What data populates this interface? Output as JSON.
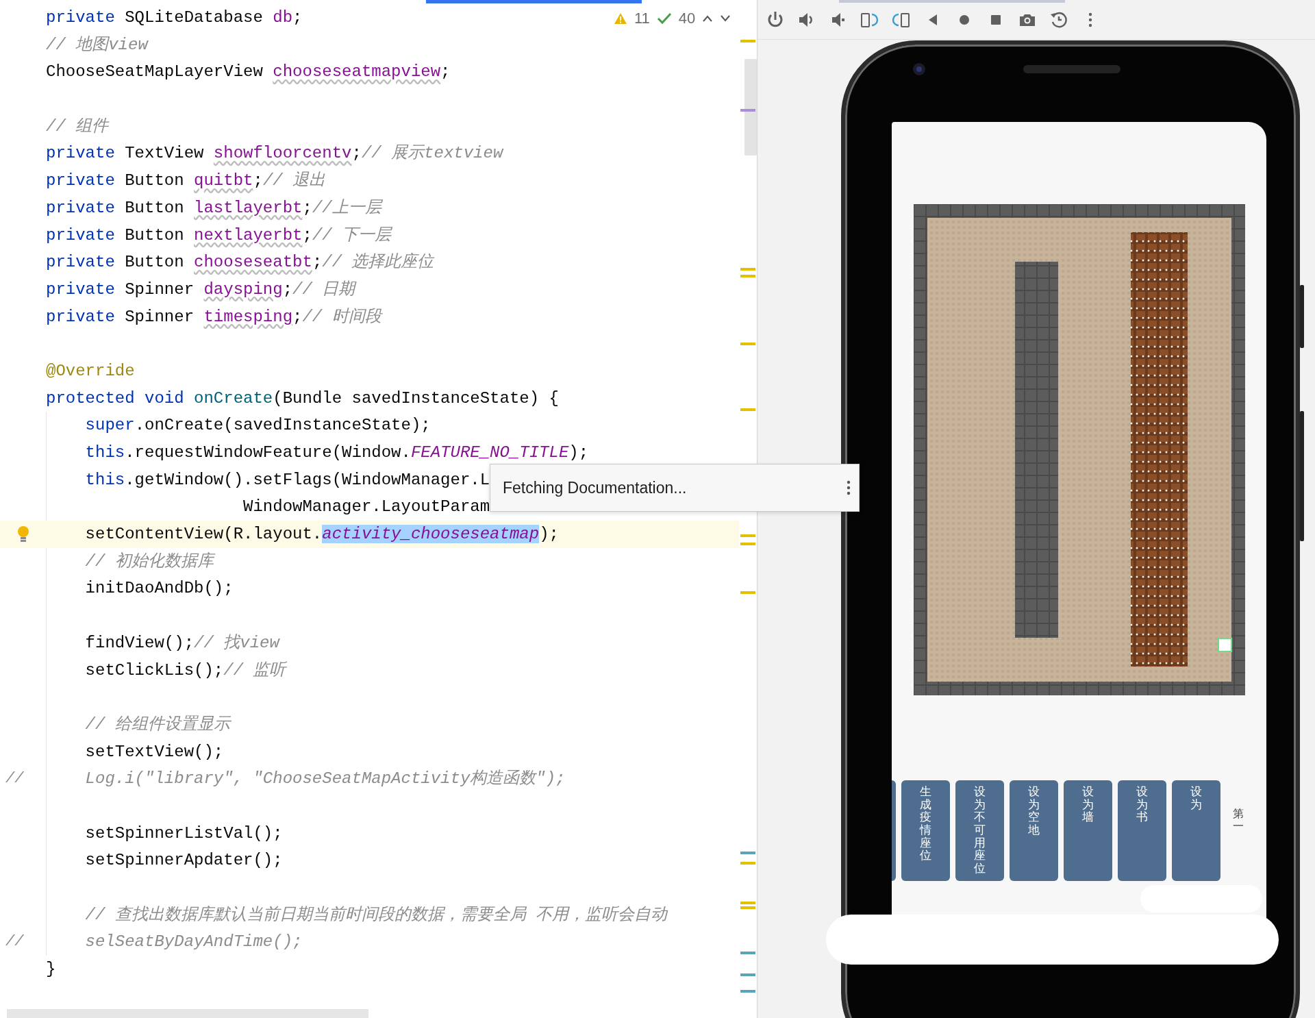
{
  "editor": {
    "inspections": {
      "warnings": "11",
      "weak_warnings": "40"
    },
    "lines": [
      {
        "tokens": [
          {
            "text": "private ",
            "kind": "keyword"
          },
          {
            "text": "SQLiteDatabase ",
            "kind": "plain"
          },
          {
            "text": "db",
            "kind": "field"
          },
          {
            "text": ";",
            "kind": "plain"
          }
        ]
      },
      {
        "tokens": [
          {
            "text": "// 地图view",
            "kind": "comment"
          }
        ]
      },
      {
        "tokens": [
          {
            "text": "ChooseSeatMapLayerView ",
            "kind": "plain"
          },
          {
            "text": "chooseseatmapview",
            "kind": "unusedfield"
          },
          {
            "text": ";",
            "kind": "plain"
          }
        ]
      },
      {
        "kind": "blank"
      },
      {
        "tokens": [
          {
            "text": "// 组件",
            "kind": "comment"
          }
        ]
      },
      {
        "tokens": [
          {
            "text": "private ",
            "kind": "keyword"
          },
          {
            "text": "TextView ",
            "kind": "plain"
          },
          {
            "text": "showfloorcentv",
            "kind": "unusedfield"
          },
          {
            "text": ";",
            "kind": "plain"
          },
          {
            "text": "// 展示textview",
            "kind": "comment"
          }
        ]
      },
      {
        "tokens": [
          {
            "text": "private ",
            "kind": "keyword"
          },
          {
            "text": "Button ",
            "kind": "plain"
          },
          {
            "text": "quitbt",
            "kind": "unusedfield"
          },
          {
            "text": ";",
            "kind": "plain"
          },
          {
            "text": "// 退出",
            "kind": "comment"
          }
        ]
      },
      {
        "tokens": [
          {
            "text": "private ",
            "kind": "keyword"
          },
          {
            "text": "Button ",
            "kind": "plain"
          },
          {
            "text": "lastlayerbt",
            "kind": "unusedfield"
          },
          {
            "text": ";",
            "kind": "plain"
          },
          {
            "text": "//上一层",
            "kind": "comment"
          }
        ]
      },
      {
        "tokens": [
          {
            "text": "private ",
            "kind": "keyword"
          },
          {
            "text": "Button ",
            "kind": "plain"
          },
          {
            "text": "nextlayerbt",
            "kind": "unusedfield"
          },
          {
            "text": ";",
            "kind": "plain"
          },
          {
            "text": "// 下一层",
            "kind": "comment"
          }
        ]
      },
      {
        "tokens": [
          {
            "text": "private ",
            "kind": "keyword"
          },
          {
            "text": "Button ",
            "kind": "plain"
          },
          {
            "text": "chooseseatbt",
            "kind": "unusedfield"
          },
          {
            "text": ";",
            "kind": "plain"
          },
          {
            "text": "// 选择此座位",
            "kind": "comment"
          }
        ]
      },
      {
        "tokens": [
          {
            "text": "private ",
            "kind": "keyword"
          },
          {
            "text": "Spinner ",
            "kind": "plain"
          },
          {
            "text": "daysping",
            "kind": "unusedfield"
          },
          {
            "text": ";",
            "kind": "plain"
          },
          {
            "text": "// 日期",
            "kind": "comment"
          }
        ]
      },
      {
        "tokens": [
          {
            "text": "private ",
            "kind": "keyword"
          },
          {
            "text": "Spinner ",
            "kind": "plain"
          },
          {
            "text": "timesping",
            "kind": "unusedfield"
          },
          {
            "text": ";",
            "kind": "plain"
          },
          {
            "text": "// 时间段",
            "kind": "comment"
          }
        ]
      },
      {
        "kind": "blank"
      },
      {
        "tokens": [
          {
            "text": "@Override",
            "kind": "annotation"
          }
        ]
      },
      {
        "tokens": [
          {
            "text": "protected void ",
            "kind": "keyword"
          },
          {
            "text": "onCreate",
            "kind": "method"
          },
          {
            "text": "(Bundle savedInstanceState) {",
            "kind": "plain"
          }
        ],
        "children": [
          {
            "tokens": [
              {
                "text": "super",
                "kind": "keyword"
              },
              {
                "text": ".onCreate(savedInstanceState);",
                "kind": "plain"
              }
            ]
          },
          {
            "tokens": [
              {
                "text": "this",
                "kind": "keyword"
              },
              {
                "text": ".requestWindowFeature(Window.",
                "kind": "plain"
              },
              {
                "text": "FEATURE_NO_TITLE",
                "kind": "static"
              },
              {
                "text": ");",
                "kind": "plain"
              }
            ]
          },
          {
            "tokens": [
              {
                "text": "this",
                "kind": "keyword"
              },
              {
                "text": ".getWindow().setFlags(WindowManager.L",
                "kind": "plain"
              }
            ],
            "children": [
              {
                "tokens": [
                  {
                    "text": "WindowManager.LayoutParam",
                    "kind": "plain"
                  }
                ]
              }
            ]
          },
          {
            "current": true,
            "lightbulb": true,
            "tokens": [
              {
                "text": "setContentView(R.layout.",
                "kind": "plain"
              },
              {
                "text": "activity_chooseseatmap",
                "kind": "static",
                "selected": true
              },
              {
                "text": ");",
                "kind": "plain"
              }
            ]
          },
          {
            "tokens": [
              {
                "text": "// 初始化数据库",
                "kind": "comment"
              }
            ]
          },
          {
            "tokens": [
              {
                "text": "initDaoAndDb();",
                "kind": "plain"
              }
            ]
          },
          {
            "kind": "blank"
          },
          {
            "tokens": [
              {
                "text": "findView();",
                "kind": "plain"
              },
              {
                "text": "// 找view",
                "kind": "comment"
              }
            ]
          },
          {
            "tokens": [
              {
                "text": "setClickLis();",
                "kind": "plain"
              },
              {
                "text": "// 监听",
                "kind": "comment"
              }
            ]
          },
          {
            "kind": "blank"
          },
          {
            "tokens": [
              {
                "text": "// 给组件设置显示",
                "kind": "comment"
              }
            ]
          },
          {
            "tokens": [
              {
                "text": "setTextView();",
                "kind": "plain"
              }
            ]
          },
          {
            "gutter": "//",
            "tokens": [
              {
                "text": "Log.i(\"library\", \"ChooseSeatMapActivity构造函数\");",
                "kind": "comment"
              }
            ]
          },
          {
            "kind": "blank"
          },
          {
            "tokens": [
              {
                "text": "setSpinnerListVal();",
                "kind": "plain"
              }
            ]
          },
          {
            "tokens": [
              {
                "text": "setSpinnerApdater();",
                "kind": "plain"
              }
            ]
          },
          {
            "kind": "blank"
          },
          {
            "tokens": [
              {
                "text": "// 查找出数据库默认当前日期当前时间段的数据，需要全局 不用，监听会自动",
                "kind": "comment"
              }
            ]
          },
          {
            "gutter": "//",
            "tokens": [
              {
                "text": "selSeatByDayAndTime();",
                "kind": "comment"
              }
            ]
          }
        ]
      },
      {
        "tokens": [
          {
            "text": "}",
            "kind": "plain"
          }
        ]
      }
    ],
    "popup": {
      "text": "Fetching Documentation..."
    }
  },
  "emulator": {
    "app_buttons": [
      {
        "label": "生成疫情座位"
      },
      {
        "label": "设为不可用座位"
      },
      {
        "label": "设为空地"
      },
      {
        "label": "设为墙"
      },
      {
        "label": "设为书"
      },
      {
        "label": "设为"
      }
    ],
    "side_label": "第一"
  }
}
